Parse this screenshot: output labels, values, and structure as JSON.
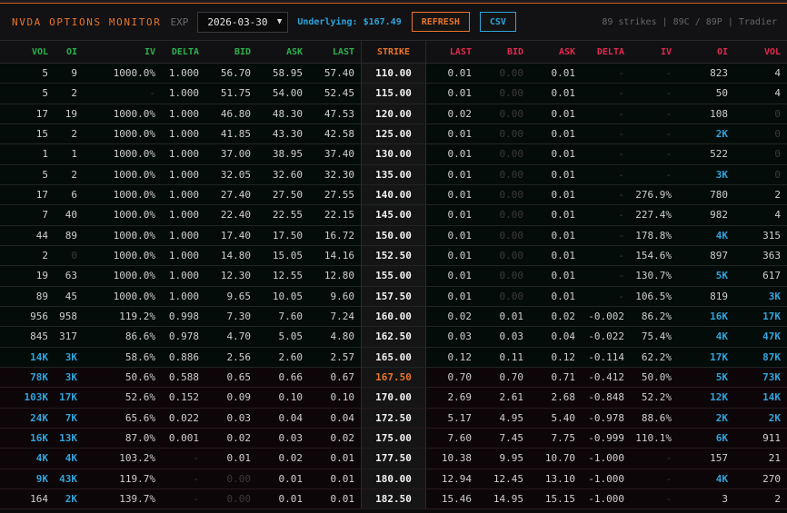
{
  "header": {
    "title": "NVDA OPTIONS MONITOR",
    "exp_label": "EXP",
    "expiry": "2026-03-30",
    "underlying": "Underlying: $167.49",
    "refresh": "REFRESH",
    "csv": "CSV",
    "meta": "89 strikes | 89C / 89P | Tradier"
  },
  "columns": {
    "calls": [
      "VOL",
      "OI",
      "IV",
      "DELTA",
      "BID",
      "ASK",
      "LAST"
    ],
    "strike": "STRIKE",
    "puts": [
      "LAST",
      "BID",
      "ASK",
      "DELTA",
      "IV",
      "OI",
      "VOL"
    ]
  },
  "colors": {
    "accent": "#e8742a",
    "calls": "#2bb24c",
    "puts": "#e0294f",
    "highlight": "#2fa4dc"
  },
  "atm_strike": "167.50",
  "rows": [
    {
      "strike": "110.00",
      "itm": true,
      "call": [
        "5",
        "9",
        "1000.0%",
        "1.000",
        "56.70",
        "58.95",
        "57.40"
      ],
      "put": [
        "0.01",
        "0.00",
        "0.01",
        "-",
        "-",
        "823",
        "4"
      ]
    },
    {
      "strike": "115.00",
      "itm": true,
      "call": [
        "5",
        "2",
        "-",
        "1.000",
        "51.75",
        "54.00",
        "52.45"
      ],
      "put": [
        "0.01",
        "0.00",
        "0.01",
        "-",
        "-",
        "50",
        "4"
      ]
    },
    {
      "strike": "120.00",
      "itm": true,
      "call": [
        "17",
        "19",
        "1000.0%",
        "1.000",
        "46.80",
        "48.30",
        "47.53"
      ],
      "put": [
        "0.02",
        "0.00",
        "0.01",
        "-",
        "-",
        "108",
        "0"
      ]
    },
    {
      "strike": "125.00",
      "itm": true,
      "call": [
        "15",
        "2",
        "1000.0%",
        "1.000",
        "41.85",
        "43.30",
        "42.58"
      ],
      "put": [
        "0.01",
        "0.00",
        "0.01",
        "-",
        "-",
        "2K",
        "0"
      ]
    },
    {
      "strike": "130.00",
      "itm": true,
      "call": [
        "1",
        "1",
        "1000.0%",
        "1.000",
        "37.00",
        "38.95",
        "37.40"
      ],
      "put": [
        "0.01",
        "0.00",
        "0.01",
        "-",
        "-",
        "522",
        "0"
      ]
    },
    {
      "strike": "135.00",
      "itm": true,
      "call": [
        "5",
        "2",
        "1000.0%",
        "1.000",
        "32.05",
        "32.60",
        "32.30"
      ],
      "put": [
        "0.01",
        "0.00",
        "0.01",
        "-",
        "-",
        "3K",
        "0"
      ]
    },
    {
      "strike": "140.00",
      "itm": true,
      "call": [
        "17",
        "6",
        "1000.0%",
        "1.000",
        "27.40",
        "27.50",
        "27.55"
      ],
      "put": [
        "0.01",
        "0.00",
        "0.01",
        "-",
        "276.9%",
        "780",
        "2"
      ]
    },
    {
      "strike": "145.00",
      "itm": true,
      "call": [
        "7",
        "40",
        "1000.0%",
        "1.000",
        "22.40",
        "22.55",
        "22.15"
      ],
      "put": [
        "0.01",
        "0.00",
        "0.01",
        "-",
        "227.4%",
        "982",
        "4"
      ]
    },
    {
      "strike": "150.00",
      "itm": true,
      "call": [
        "44",
        "89",
        "1000.0%",
        "1.000",
        "17.40",
        "17.50",
        "16.72"
      ],
      "put": [
        "0.01",
        "0.00",
        "0.01",
        "-",
        "178.8%",
        "4K",
        "315"
      ]
    },
    {
      "strike": "152.50",
      "itm": true,
      "call": [
        "2",
        "0",
        "1000.0%",
        "1.000",
        "14.80",
        "15.05",
        "14.16"
      ],
      "put": [
        "0.01",
        "0.00",
        "0.01",
        "-",
        "154.6%",
        "897",
        "363"
      ]
    },
    {
      "strike": "155.00",
      "itm": true,
      "call": [
        "19",
        "63",
        "1000.0%",
        "1.000",
        "12.30",
        "12.55",
        "12.80"
      ],
      "put": [
        "0.01",
        "0.00",
        "0.01",
        "-",
        "130.7%",
        "5K",
        "617"
      ]
    },
    {
      "strike": "157.50",
      "itm": true,
      "call": [
        "89",
        "45",
        "1000.0%",
        "1.000",
        "9.65",
        "10.05",
        "9.60"
      ],
      "put": [
        "0.01",
        "0.00",
        "0.01",
        "-",
        "106.5%",
        "819",
        "3K"
      ]
    },
    {
      "strike": "160.00",
      "itm": true,
      "call": [
        "956",
        "958",
        "119.2%",
        "0.998",
        "7.30",
        "7.60",
        "7.24"
      ],
      "put": [
        "0.02",
        "0.01",
        "0.02",
        "-0.002",
        "86.2%",
        "16K",
        "17K"
      ]
    },
    {
      "strike": "162.50",
      "itm": true,
      "call": [
        "845",
        "317",
        "86.6%",
        "0.978",
        "4.70",
        "5.05",
        "4.80"
      ],
      "put": [
        "0.03",
        "0.03",
        "0.04",
        "-0.022",
        "75.4%",
        "4K",
        "47K"
      ]
    },
    {
      "strike": "165.00",
      "itm": true,
      "call": [
        "14K",
        "3K",
        "58.6%",
        "0.886",
        "2.56",
        "2.60",
        "2.57"
      ],
      "put": [
        "0.12",
        "0.11",
        "0.12",
        "-0.114",
        "62.2%",
        "17K",
        "87K"
      ]
    },
    {
      "strike": "167.50",
      "itm": false,
      "call": [
        "78K",
        "3K",
        "50.6%",
        "0.588",
        "0.65",
        "0.66",
        "0.67"
      ],
      "put": [
        "0.70",
        "0.70",
        "0.71",
        "-0.412",
        "50.0%",
        "5K",
        "73K"
      ]
    },
    {
      "strike": "170.00",
      "itm": false,
      "call": [
        "103K",
        "17K",
        "52.6%",
        "0.152",
        "0.09",
        "0.10",
        "0.10"
      ],
      "put": [
        "2.69",
        "2.61",
        "2.68",
        "-0.848",
        "52.2%",
        "12K",
        "14K"
      ]
    },
    {
      "strike": "172.50",
      "itm": false,
      "call": [
        "24K",
        "7K",
        "65.6%",
        "0.022",
        "0.03",
        "0.04",
        "0.04"
      ],
      "put": [
        "5.17",
        "4.95",
        "5.40",
        "-0.978",
        "88.6%",
        "2K",
        "2K"
      ]
    },
    {
      "strike": "175.00",
      "itm": false,
      "call": [
        "16K",
        "13K",
        "87.0%",
        "0.001",
        "0.02",
        "0.03",
        "0.02"
      ],
      "put": [
        "7.60",
        "7.45",
        "7.75",
        "-0.999",
        "110.1%",
        "6K",
        "911"
      ]
    },
    {
      "strike": "177.50",
      "itm": false,
      "call": [
        "4K",
        "4K",
        "103.2%",
        "-",
        "0.01",
        "0.02",
        "0.01"
      ],
      "put": [
        "10.38",
        "9.95",
        "10.70",
        "-1.000",
        "-",
        "157",
        "21"
      ]
    },
    {
      "strike": "180.00",
      "itm": false,
      "call": [
        "9K",
        "43K",
        "119.7%",
        "-",
        "0.00",
        "0.01",
        "0.01"
      ],
      "put": [
        "12.94",
        "12.45",
        "13.10",
        "-1.000",
        "-",
        "4K",
        "270"
      ]
    },
    {
      "strike": "182.50",
      "itm": false,
      "call": [
        "164",
        "2K",
        "139.7%",
        "-",
        "0.00",
        "0.01",
        "0.01"
      ],
      "put": [
        "15.46",
        "14.95",
        "15.15",
        "-1.000",
        "-",
        "3",
        "2"
      ]
    }
  ]
}
